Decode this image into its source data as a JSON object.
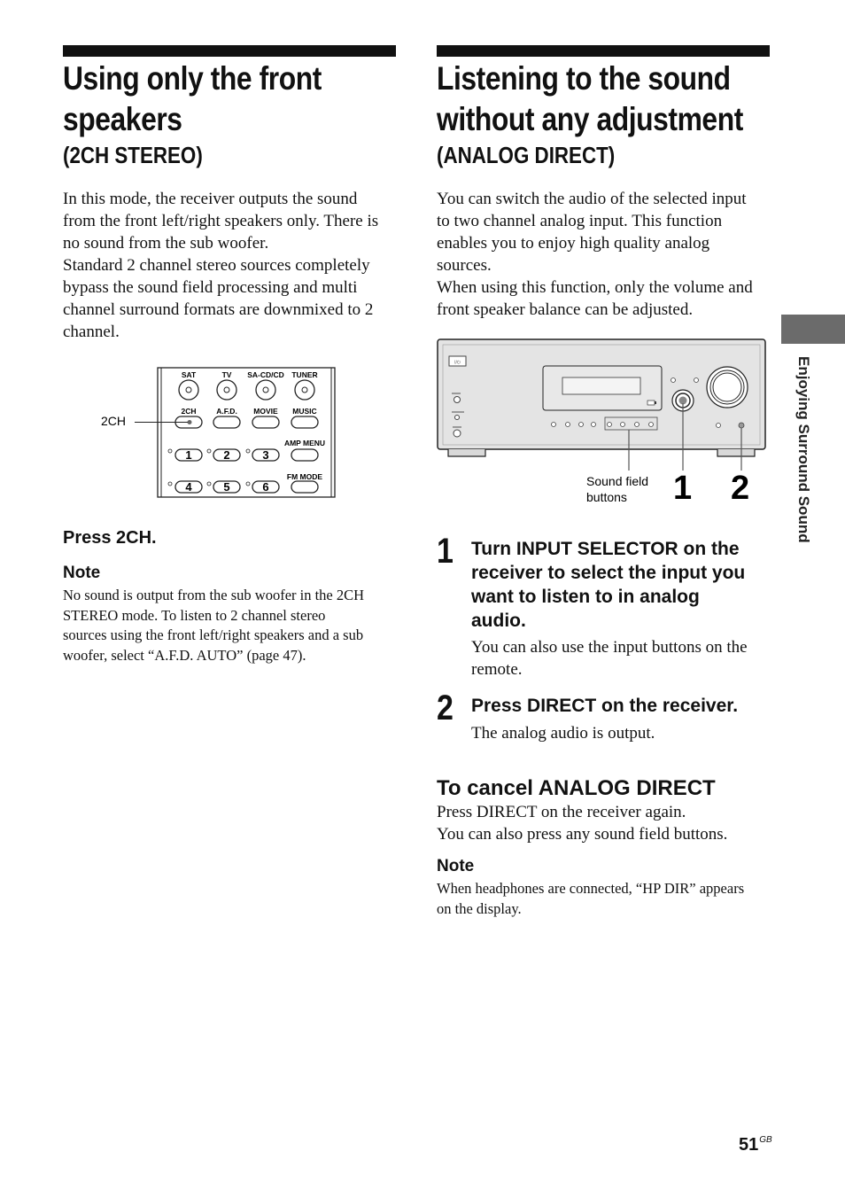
{
  "left": {
    "title_line1": "Using only the front",
    "title_line2": "speakers",
    "subtitle": "(2CH STEREO)",
    "para": [
      "In this mode, the receiver outputs the sound",
      "from the front left/right speakers only. There is",
      "no sound from the sub woofer.",
      "Standard 2 channel stereo sources completely",
      "bypass the sound field processing and multi",
      "channel surround formats are downmixed to 2",
      "channel."
    ],
    "remote": {
      "callout": "2CH",
      "row1": [
        "SAT",
        "TV",
        "SA-CD/CD",
        "TUNER"
      ],
      "row2": [
        "2CH",
        "A.F.D.",
        "MOVIE",
        "MUSIC"
      ],
      "row3": [
        "1",
        "2",
        "3"
      ],
      "row3_label": "AMP MENU",
      "row4": [
        "4",
        "5",
        "6"
      ],
      "row4_label": "FM MODE"
    },
    "instruction": "Press 2CH.",
    "note_heading": "Note",
    "note": [
      "No sound is output from the sub woofer in the 2CH",
      "STEREO mode. To listen to 2 channel stereo",
      "sources using the front left/right speakers and a sub",
      "woofer, select “A.F.D. AUTO” (page 47)."
    ]
  },
  "right": {
    "title_line1": "Listening to the sound",
    "title_line2": "without any adjustment",
    "subtitle": "(ANALOG DIRECT)",
    "para": [
      "You can switch the audio of the selected input",
      "to two channel analog input. This function",
      "enables you to enjoy high quality analog",
      "sources.",
      "When using this function, only the volume and",
      "front speaker balance can be adjusted."
    ],
    "figure": {
      "sound_field_label_1": "Sound field",
      "sound_field_label_2": "buttons",
      "callout_1": "1",
      "callout_2": "2"
    },
    "steps": [
      {
        "num": "1",
        "lines": [
          "Turn INPUT SELECTOR on the",
          "receiver to select the input you",
          "want to listen to in analog",
          "audio."
        ],
        "detail": [
          "You can also use the input buttons on the",
          "remote."
        ]
      },
      {
        "num": "2",
        "lines": [
          "Press DIRECT on the receiver."
        ],
        "detail": [
          "The analog audio is output."
        ]
      }
    ],
    "cancel_heading": "To cancel ANALOG DIRECT",
    "cancel_text": [
      "Press DIRECT on the receiver again.",
      "You can also press any sound field buttons."
    ],
    "note_heading": "Note",
    "note": [
      "When headphones are connected, “HP DIR” appears",
      "on the display."
    ]
  },
  "sidebar_label": "Enjoying Surround Sound",
  "page_number": "51",
  "page_suffix": "GB"
}
